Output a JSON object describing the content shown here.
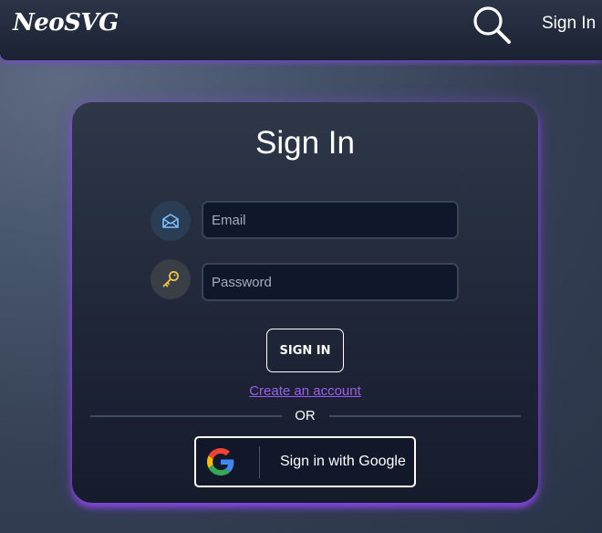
{
  "header": {
    "logo": "NeoSVG",
    "search_icon": "search-icon",
    "signin_label": "Sign In"
  },
  "card": {
    "title": "Sign In",
    "email": {
      "icon": "envelope-icon",
      "placeholder": "Email",
      "value": ""
    },
    "password": {
      "icon": "key-icon",
      "placeholder": "Password",
      "value": ""
    },
    "submit_label": "SIGN IN",
    "create_account_label": "Create an account",
    "divider_text": "OR",
    "google": {
      "icon": "google-icon",
      "label": "Sign in with Google"
    }
  },
  "colors": {
    "accent_glow": "#8b46e6",
    "link": "#9d5cf0",
    "field_bg": "#0f172a",
    "email_icon": "#7cc0ff",
    "key_icon": "#f2c94c"
  }
}
